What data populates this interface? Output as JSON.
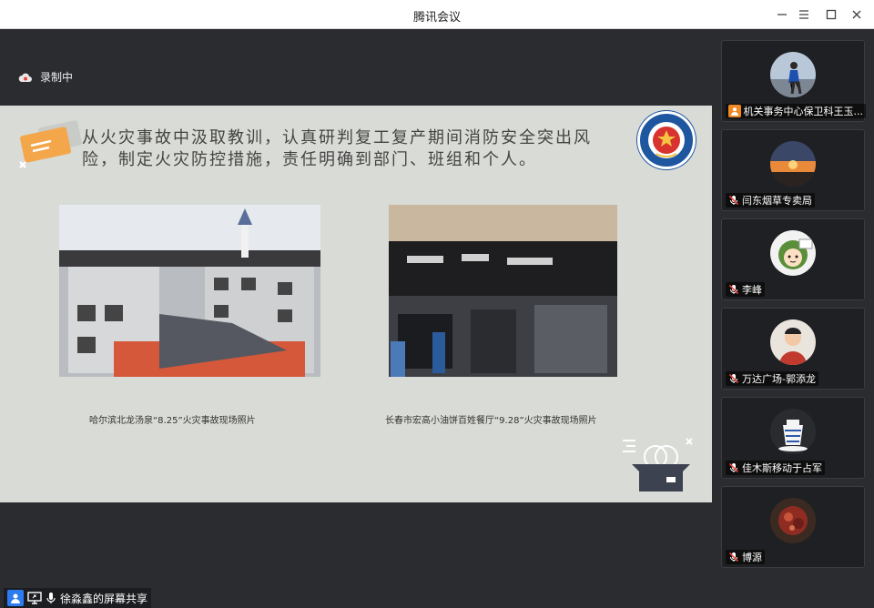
{
  "window": {
    "title": "腾讯会议"
  },
  "recording": {
    "label": "录制中"
  },
  "slide": {
    "heading": "从火灾事故中汲取教训，认真研判复工复产期间消防安全突出风险，制定火灾防控措施，责任明确到部门、班组和个人。",
    "captions": [
      "哈尔滨北龙汤泉“8.25”火灾事故现场照片",
      "长春市宏高小油饼百姓餐厅“9.28”火灾事故现场照片"
    ]
  },
  "participants": [
    {
      "name": "机关事务中心保卫科王玉..."
    },
    {
      "name": "闫东烟草专卖局"
    },
    {
      "name": "李峰"
    },
    {
      "name": "万达广场-郭添龙"
    },
    {
      "name": "佳木斯移动于占军"
    },
    {
      "name": "博源"
    }
  ],
  "share": {
    "label": "徐淼鑫的屏幕共享"
  },
  "colors": {
    "accent": "#2d7bf0",
    "recording": "#e8453c"
  }
}
